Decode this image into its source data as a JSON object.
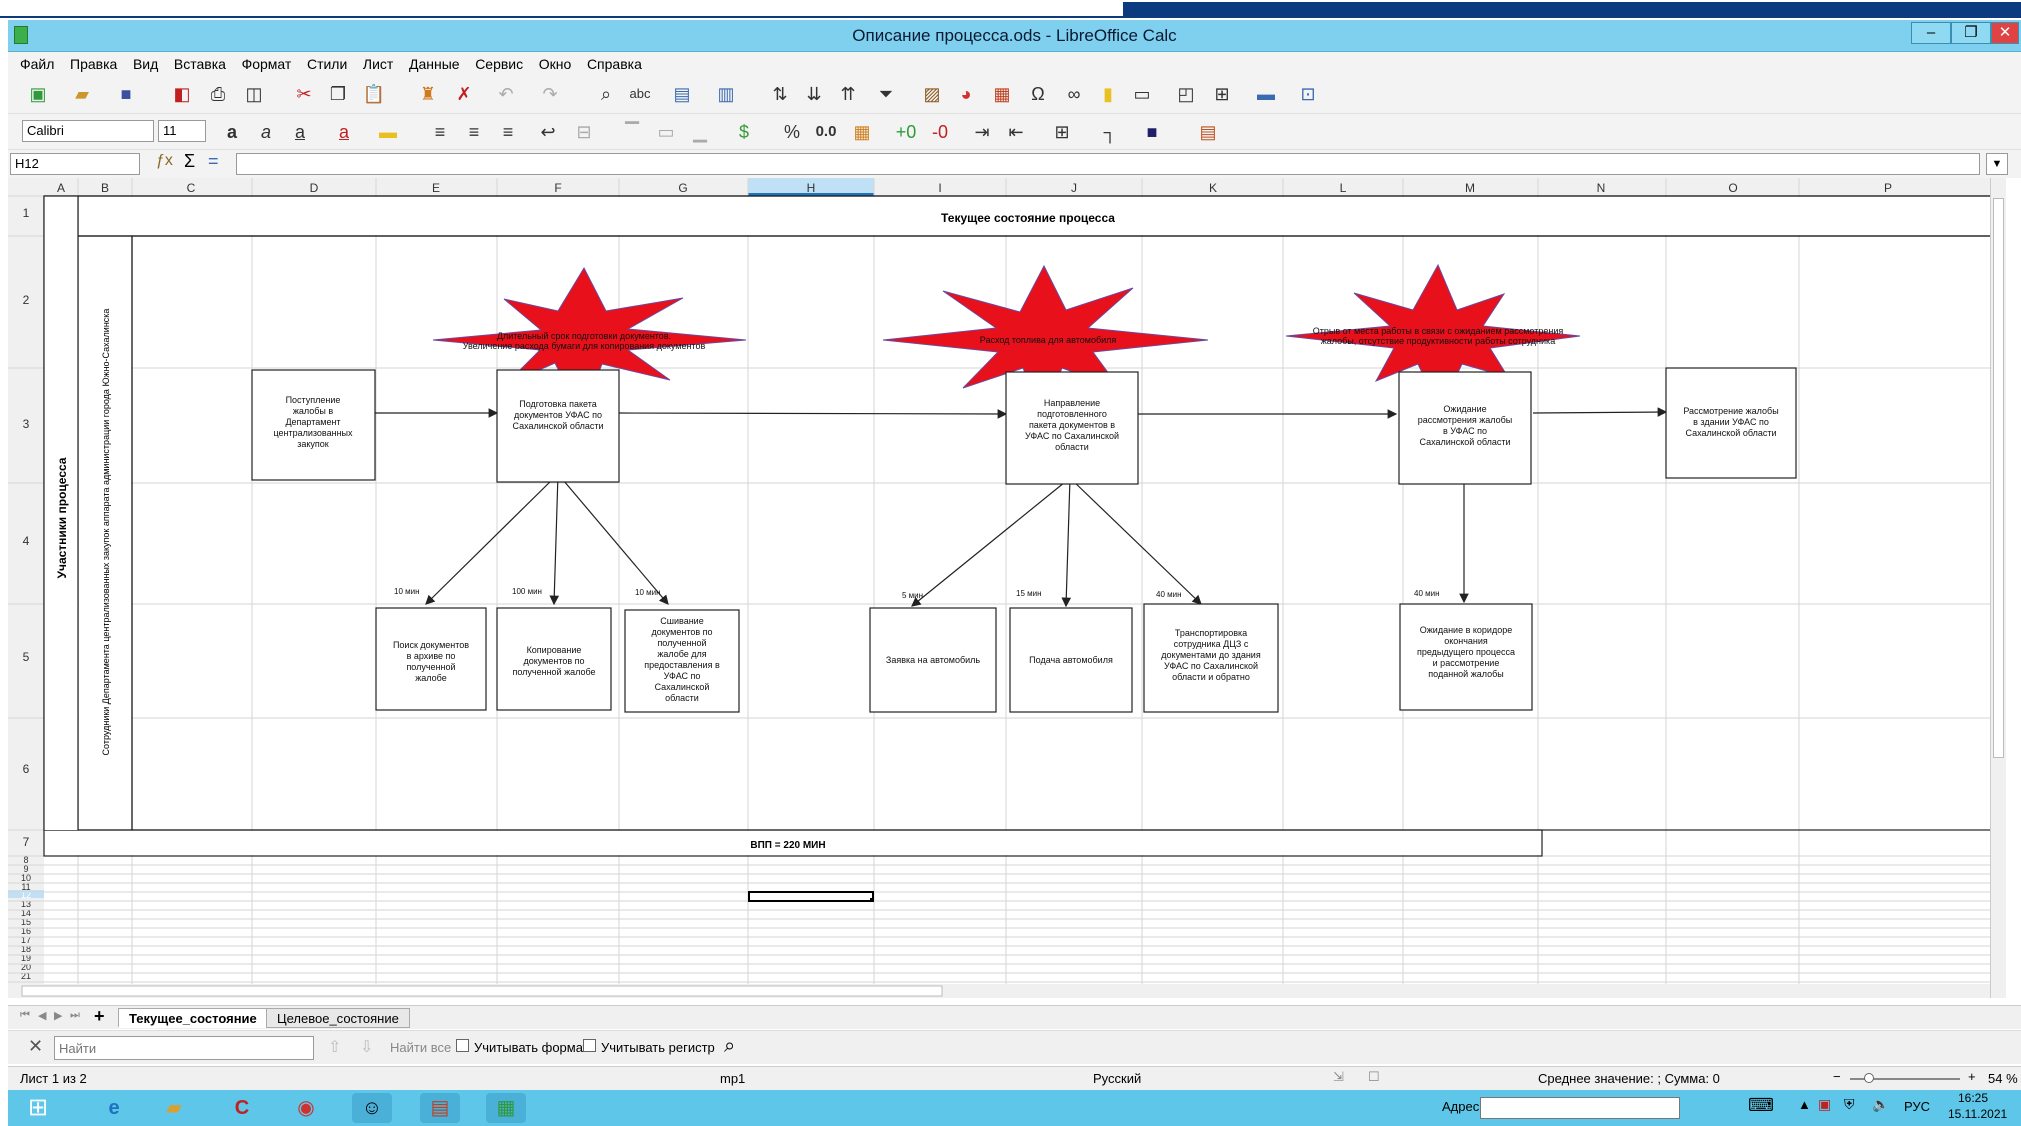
{
  "window": {
    "title": "Описание процесса.ods - LibreOffice Calc"
  },
  "menu": [
    "Файл",
    "Правка",
    "Вид",
    "Вставка",
    "Формат",
    "Стили",
    "Лист",
    "Данные",
    "Сервис",
    "Окно",
    "Справка"
  ],
  "format_bar": {
    "font": "Calibri",
    "size": "11"
  },
  "formula_bar": {
    "cell_ref": "H12",
    "content": ""
  },
  "columns": [
    "A",
    "B",
    "C",
    "D",
    "E",
    "F",
    "G",
    "H",
    "I",
    "J",
    "K",
    "L",
    "M",
    "N",
    "O",
    "P"
  ],
  "rows": [
    "1",
    "2",
    "3",
    "4",
    "5",
    "6",
    "7",
    "8",
    "9",
    "10",
    "11",
    "12",
    "13",
    "14",
    "15",
    "16",
    "17",
    "18",
    "19",
    "20",
    "21"
  ],
  "diagram": {
    "header": "Текущее состояние процесса",
    "participants_label": "Участники процесса",
    "participant_detail": "Сотрудники Департамента централизованных закупок аппарата администрации города Южно-Сахалинска",
    "main_steps": [
      "Поступление жалобы в Департамент централизованных закупок",
      "Подготовка пакета документов УФАС по Сахалинской области",
      "Направление подготовленного пакета документов в УФАС по Сахалинской области",
      "Ожидание рассмотрения жалобы в УФАС по Сахалинской области",
      "Рассмотрение жалобы в здании УФАС по Сахалинской области"
    ],
    "sub_steps": [
      "Поиск документов в архиве по полученной жалобе",
      "Копирование документов по полученной жалобе",
      "Сшивание документов по полученной жалобе для предоставления в УФАС по Сахалинской области",
      "Заявка на автомобиль",
      "Подача автомобиля",
      "Транспортировка сотрудника ДЦЗ с документами до здания УФАС по Сахалинской области и обратно",
      "Ожидание в коридоре окончания предыдущего процесса и рассмотрение поданной жалобы"
    ],
    "times": [
      "10 мин",
      "100 мин",
      "10 мин",
      "5 мин",
      "15 мин",
      "40 мин",
      "40 мин"
    ],
    "problems": [
      "Длительный срок подготовки документов. Увеличение расхода бумаги для копирования документов",
      "Расход топлива для автомобиля",
      "Отрыв от места работы в связи с ожиданием рассмотрения жалобы, отсутствие продуктивности работы сотрудника"
    ],
    "total": "ВПП = 220 МИН"
  },
  "sheet_tabs": [
    "Текущее_состояние",
    "Целевое_состояние"
  ],
  "find_bar": {
    "placeholder": "Найти",
    "find_all": "Найти все",
    "match_format": "Учитывать формат",
    "match_case": "Учитывать регистр"
  },
  "status": {
    "sheet": "Лист 1 из 2",
    "style": "mp1",
    "language": "Русский",
    "summary": "Среднее значение: ; Сумма: 0",
    "zoom": "54 %"
  },
  "taskbar": {
    "address_label": "Адрес",
    "lang": "РУС",
    "time": "16:25",
    "date": "15.11.2021"
  },
  "colors": {
    "accent": "#7fd0ef",
    "starburst": "#e8101a",
    "taskbar": "#5ec6e8"
  }
}
